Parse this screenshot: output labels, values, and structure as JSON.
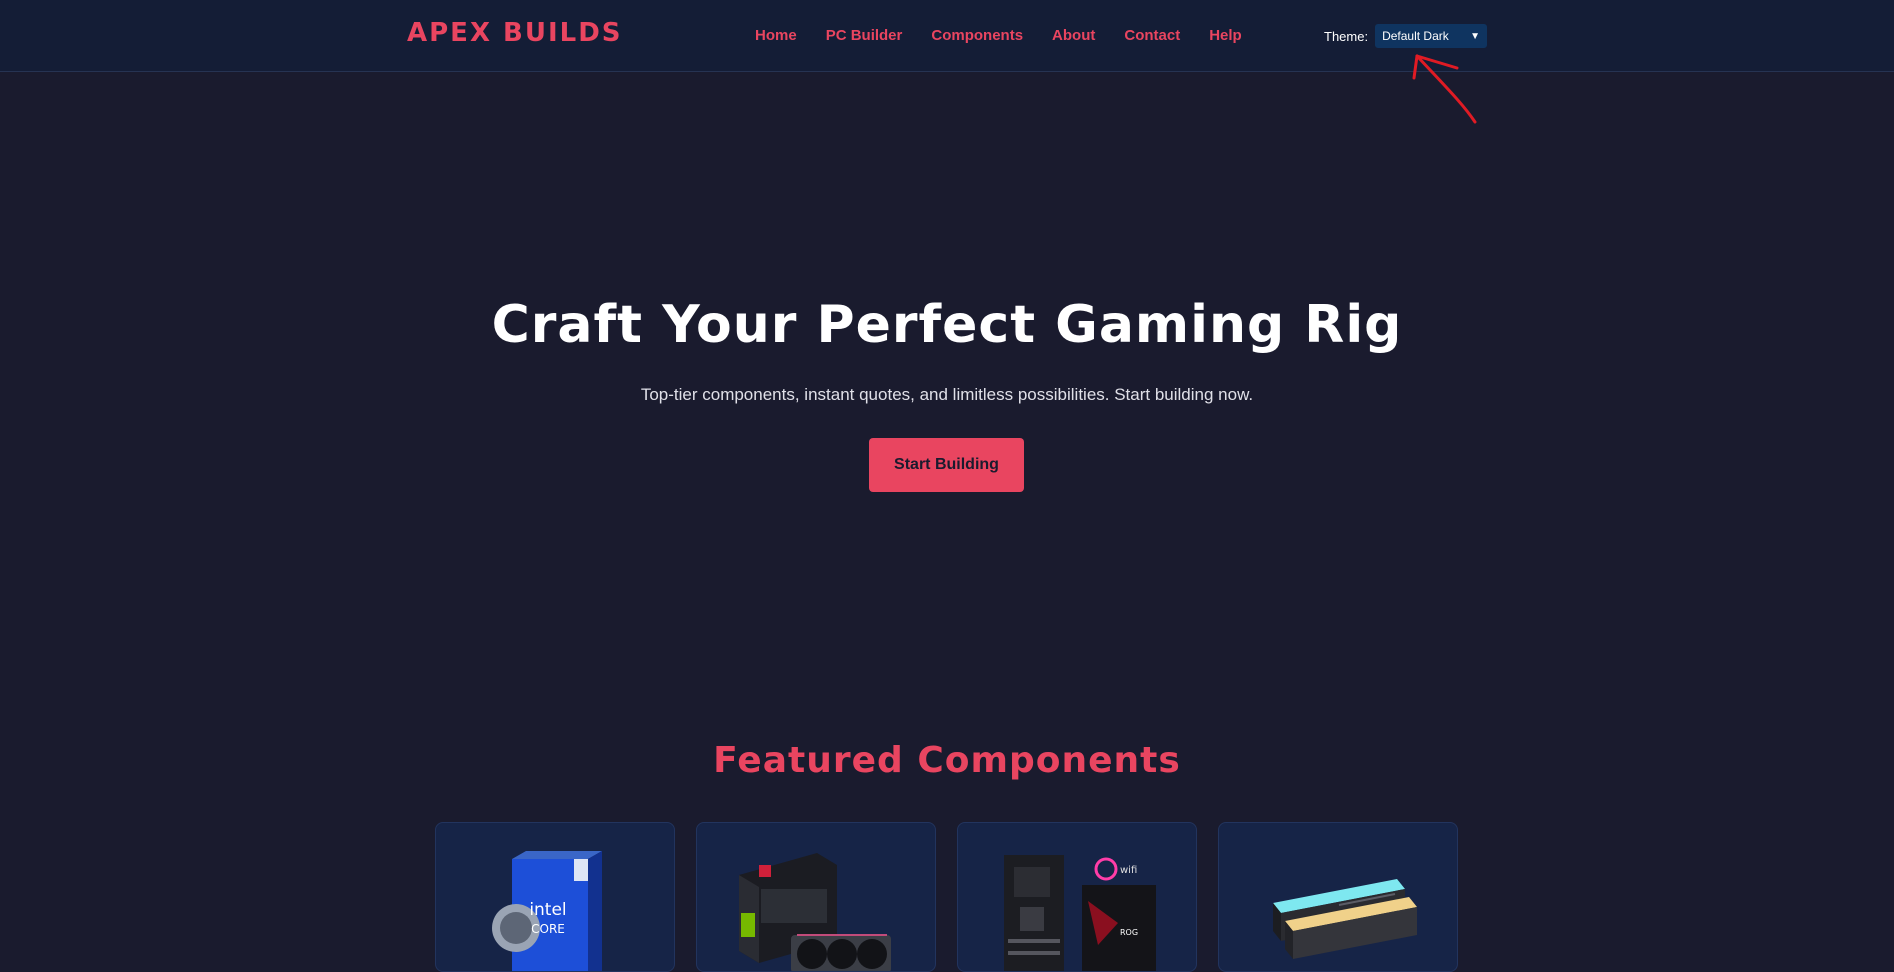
{
  "brand": {
    "name": "APEX BUILDS"
  },
  "nav": {
    "links": [
      {
        "label": "Home"
      },
      {
        "label": "PC Builder"
      },
      {
        "label": "Components"
      },
      {
        "label": "About"
      },
      {
        "label": "Contact"
      },
      {
        "label": "Help"
      }
    ]
  },
  "theme": {
    "label": "Theme:",
    "selected": "Default Dark"
  },
  "hero": {
    "title": "Craft Your Perfect Gaming Rig",
    "subtitle": "Top-tier components, instant quotes, and limitless possibilities. Start building now.",
    "cta_label": "Start Building"
  },
  "featured": {
    "title": "Featured Components",
    "cards": [
      {
        "icon": "cpu-box-icon"
      },
      {
        "icon": "gpu-icon"
      },
      {
        "icon": "motherboard-icon"
      },
      {
        "icon": "ram-icon"
      }
    ]
  },
  "colors": {
    "accent": "#e94560",
    "background": "#1a1b2e",
    "navbar": "#141d36",
    "card": "#162447",
    "select": "#0f3460",
    "annotation": "#e01b24"
  }
}
